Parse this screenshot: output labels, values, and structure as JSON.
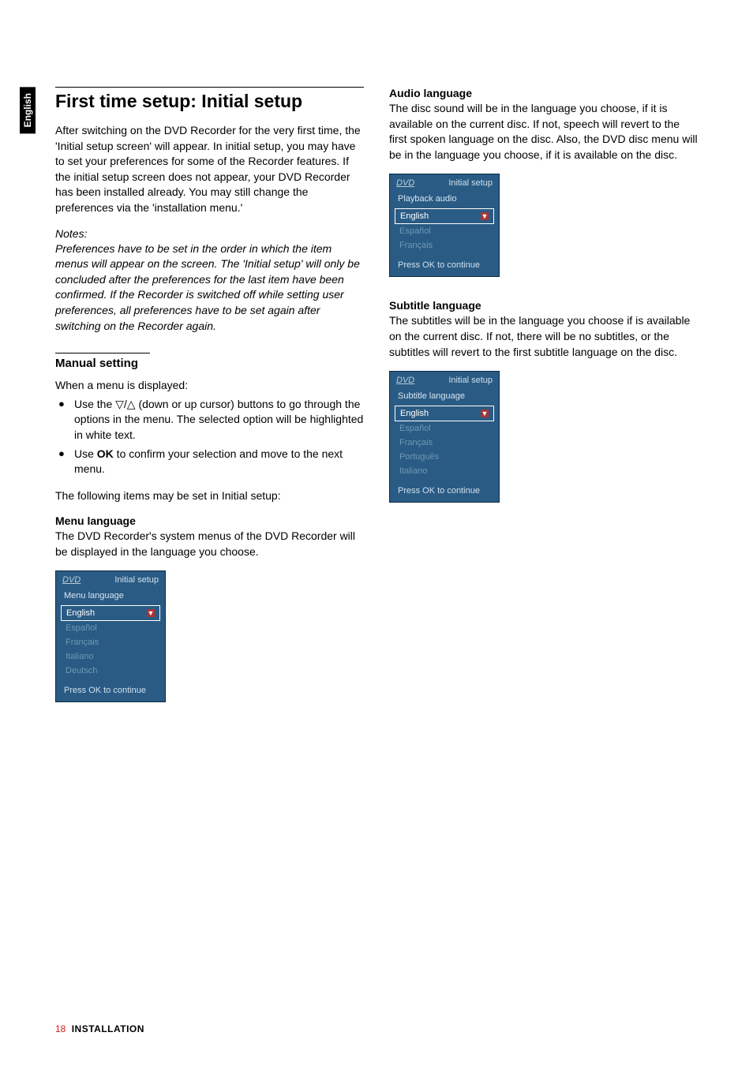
{
  "lang_tab": "English",
  "left": {
    "title": "First time setup: Initial setup",
    "intro": "After switching on the DVD Recorder for the very first time, the 'Initial setup screen' will appear. In initial setup, you may have to set your preferences for some of the Recorder features. If the initial setup screen does not appear, your DVD Recorder has been installed already. You may still change the preferences via the 'installation menu.'",
    "notes_label": "Notes:",
    "notes": "Preferences have to be set in the order in which the item menus will appear on the screen.\nThe 'Initial setup' will only be concluded after the preferences for the last item have been confirmed.\nIf the Recorder is switched off while setting user preferences, all preferences have to be set again after switching on the Recorder again.",
    "manual_heading": "Manual setting",
    "manual_intro": "When a menu is displayed:",
    "bullets": [
      "Use the ▽/△  (down or up cursor) buttons to go through the options in the menu. The selected option will be highlighted in white text.",
      {
        "pre": "Use ",
        "bold": "OK",
        "post": " to confirm your selection and move to the next menu."
      }
    ],
    "following": "The following items may be set in Initial setup:",
    "menu_lang": {
      "heading": "Menu language",
      "body": "The DVD Recorder's system menus of the DVD Recorder will be displayed in the language you choose."
    }
  },
  "right": {
    "audio": {
      "heading": "Audio language",
      "body": "The disc sound will be in the language you choose, if it is available on the current disc. If not, speech will revert to the first spoken language on the disc. Also, the DVD disc menu will be in the language you choose, if it is available on the disc."
    },
    "subtitle": {
      "heading": "Subtitle language",
      "body": "The subtitles will be in the language you choose if is available on the current disc. If not, there will be no subtitles, or the subtitles will revert to the first subtitle language on the disc."
    }
  },
  "osd_common": {
    "dvd": "DVD",
    "title": "Initial setup",
    "footer": "Press OK to continue",
    "arrow": "▼"
  },
  "osd_menu": {
    "section": "Menu language",
    "opts": [
      "English",
      "Español",
      "Français",
      "Italiano",
      "Deutsch"
    ]
  },
  "osd_audio": {
    "section": "Playback audio",
    "opts": [
      "English",
      "Español",
      "Français"
    ]
  },
  "osd_subtitle": {
    "section": "Subtitle language",
    "opts": [
      "English",
      "Español",
      "Français",
      "Português",
      "Italiano"
    ]
  },
  "footer": {
    "page": "18",
    "section": "INSTALLATION"
  }
}
